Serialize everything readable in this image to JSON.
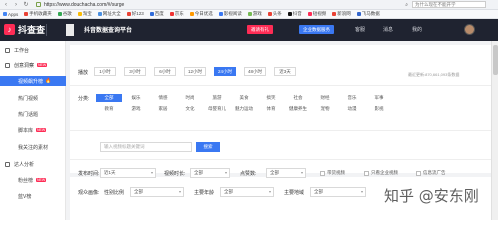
{
  "browser": {
    "url": "https://www.douchacha.com/#/surge",
    "search_placeholder": "为什么现在不能开学",
    "bookmarks": [
      "Apps",
      "手机收藏夹",
      "谷歌",
      "淘宝",
      "网址大全",
      "好123",
      "百度",
      "京东",
      "今日优选",
      "影视阅读",
      "游戏",
      "头条",
      "抖音",
      "短视频",
      "新浪网",
      "飞马数据"
    ]
  },
  "header": {
    "logo_text": "抖查查",
    "logo_mark": "♪",
    "platform": "抖音数据查询平台",
    "btn_red": "邀请有礼",
    "btn_blue": "企业数据服务",
    "links": [
      "客服",
      "消息",
      "我的"
    ]
  },
  "sidebar": {
    "items": [
      {
        "label": "工作台",
        "kind": "section"
      },
      {
        "label": "创意洞察",
        "kind": "section",
        "badge": "NEW"
      },
      {
        "label": "视频飙升榜",
        "kind": "sub",
        "active": true,
        "hot": "🔥"
      },
      {
        "label": "热门视频",
        "kind": "sub"
      },
      {
        "label": "热门话题",
        "kind": "sub"
      },
      {
        "label": "脚本库",
        "kind": "sub",
        "badge": "NEW"
      },
      {
        "label": "我关注的素材",
        "kind": "sub"
      },
      {
        "label": "达人分析",
        "kind": "section"
      },
      {
        "label": "粉丝榜",
        "kind": "sub",
        "badge": "NEW"
      },
      {
        "label": "蓝V榜",
        "kind": "sub"
      }
    ]
  },
  "filters": {
    "time_label": "播放",
    "time_options": [
      "1小时",
      "3小时",
      "6小时",
      "12小时",
      "24小时",
      "48小时",
      "近3天"
    ],
    "time_active": "24小时",
    "update_note": "最近更新:870,661,093条数据",
    "category_label": "分类:",
    "categories": [
      "全部",
      "娱乐",
      "情感",
      "时尚",
      "旅游",
      "美食",
      "搞笑",
      "社会",
      "财经",
      "音乐",
      "军事",
      "教育",
      "游戏",
      "家居",
      "文化",
      "母婴育儿",
      "魅力运动",
      "体育",
      "健康养生",
      "宠物",
      "动漫",
      "影视"
    ],
    "category_active": "全部",
    "search_placeholder": "输入视频标题关键词",
    "search_button": "搜索",
    "publish_label": "发布时间:",
    "publish_value": "近1天",
    "duration_label": "视频时长:",
    "duration_value": "全部",
    "likes_label": "点赞数:",
    "likes_value": "全部",
    "checkboxes": [
      "带货视频",
      "只看企业视频",
      "信息流广告"
    ],
    "audience_label": "观众画像:",
    "gender_label": "性别比例",
    "gender_value": "全部",
    "age_label": "主要年龄",
    "age_value": "全部",
    "region_label": "主要地域",
    "region_value": "全部"
  },
  "watermark": "知乎 @安东刚",
  "colors": {
    "brand_blue": "#3a78f2",
    "brand_red": "#fe2c55",
    "header_bg": "#1f2330"
  }
}
